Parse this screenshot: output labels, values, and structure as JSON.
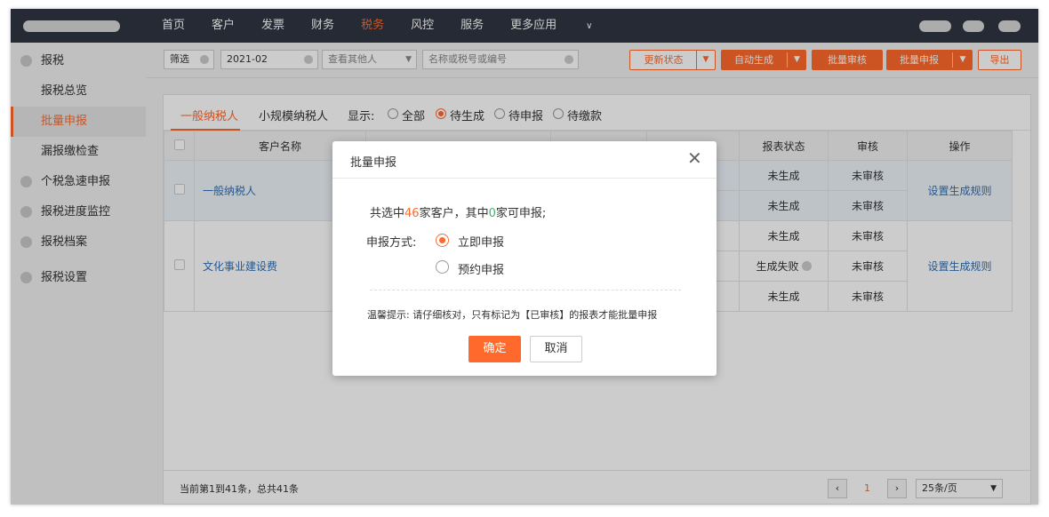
{
  "topnav": {
    "items": [
      "首页",
      "客户",
      "发票",
      "财务",
      "税务",
      "风控",
      "服务",
      "更多应用"
    ],
    "active": "税务",
    "more_chevron_icon": "chevron-down-icon"
  },
  "sidebar": {
    "items": [
      {
        "label": "报税",
        "icon": "dot"
      },
      {
        "label": "报税总览"
      },
      {
        "label": "批量申报"
      },
      {
        "label": "漏报缴检查"
      },
      {
        "label": "个税急速申报",
        "icon": "dot"
      },
      {
        "label": "报税进度监控",
        "icon": "dot"
      },
      {
        "label": "报税档案",
        "icon": "dot"
      },
      {
        "label": "报税设置",
        "icon": "dot"
      }
    ],
    "active": "批量申报"
  },
  "filterbar": {
    "filter_label": "筛选",
    "period": "2021-02",
    "view_other": "查看其他人",
    "search_placeholder": "名称或税号或编号",
    "buttons": {
      "update_status": "更新状态",
      "auto_generate": "自动生成",
      "batch_review": "批量审核",
      "batch_declare": "批量申报",
      "export": "导出"
    }
  },
  "tabs": {
    "general": "一般纳税人",
    "small": "小规模纳税人",
    "display_label": "显示:",
    "filters": [
      "全部",
      "待生成",
      "待申报",
      "待缴款"
    ],
    "selected_filter": "待生成"
  },
  "table": {
    "headers": [
      "客户名称",
      "报表状态",
      "审核",
      "操作"
    ],
    "rows": [
      {
        "name": "一般纳税人",
        "status": [
          "未生成",
          "未生成"
        ],
        "review": [
          "未审核",
          "未审核"
        ],
        "action": "设置生成规则"
      },
      {
        "name": "文化事业建设费",
        "status": [
          "未生成",
          "生成失败",
          "未生成"
        ],
        "review": [
          "未审核",
          "未审核",
          "未审核"
        ],
        "action": "设置生成规则"
      }
    ]
  },
  "footer": {
    "info": "当前第1到41条，总共41条",
    "page": "1",
    "page_size": "25条/页"
  },
  "modal": {
    "title": "批量申报",
    "summary_pre": "共选中",
    "selected_count": "46",
    "summary_mid": "家客户，其中",
    "declarable_count": "0",
    "summary_post": "家可申报;",
    "method_label": "申报方式:",
    "options": [
      "立即申报",
      "预约申报"
    ],
    "selected_option": "立即申报",
    "tip": "温馨提示: 请仔细核对，只有标记为【已审核】的报表才能批量申报",
    "confirm": "确定",
    "cancel": "取消"
  },
  "colors": {
    "accent": "#ff6a2c",
    "nav_bg": "#2f3542",
    "link": "#2f6fb5",
    "success": "#3cb371"
  }
}
